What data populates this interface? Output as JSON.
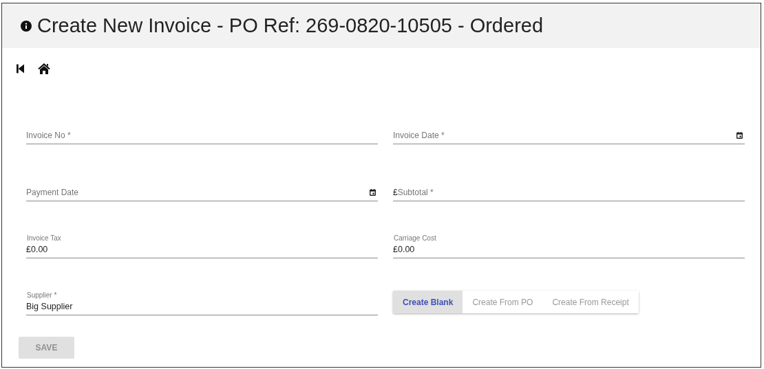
{
  "header": {
    "title": "Create New Invoice - PO Ref: 269-0820-10505 - Ordered"
  },
  "form": [
    {
      "kind": "field",
      "placeholder": "Invoice No *"
    },
    {
      "kind": "field",
      "placeholder": "Invoice Date *",
      "date_picker": true
    },
    {
      "kind": "field",
      "placeholder": "Payment Date",
      "date_picker": true
    },
    {
      "kind": "field",
      "prefix": "£",
      "placeholder": "Subtotal *"
    },
    {
      "kind": "field",
      "label": "Invoice Tax",
      "value": "£0.00"
    },
    {
      "kind": "field",
      "label": "Carriage Cost",
      "value": "£0.00"
    },
    {
      "kind": "field",
      "label": "Supplier *",
      "value": "Big Supplier"
    },
    {
      "kind": "toggle",
      "options": [
        {
          "label": "Create Blank",
          "selected": true
        },
        {
          "label": "Create From PO",
          "selected": false
        },
        {
          "label": "Create From Receipt",
          "selected": false
        }
      ]
    }
  ],
  "save_button": {
    "label": "SAVE",
    "disabled": true
  }
}
